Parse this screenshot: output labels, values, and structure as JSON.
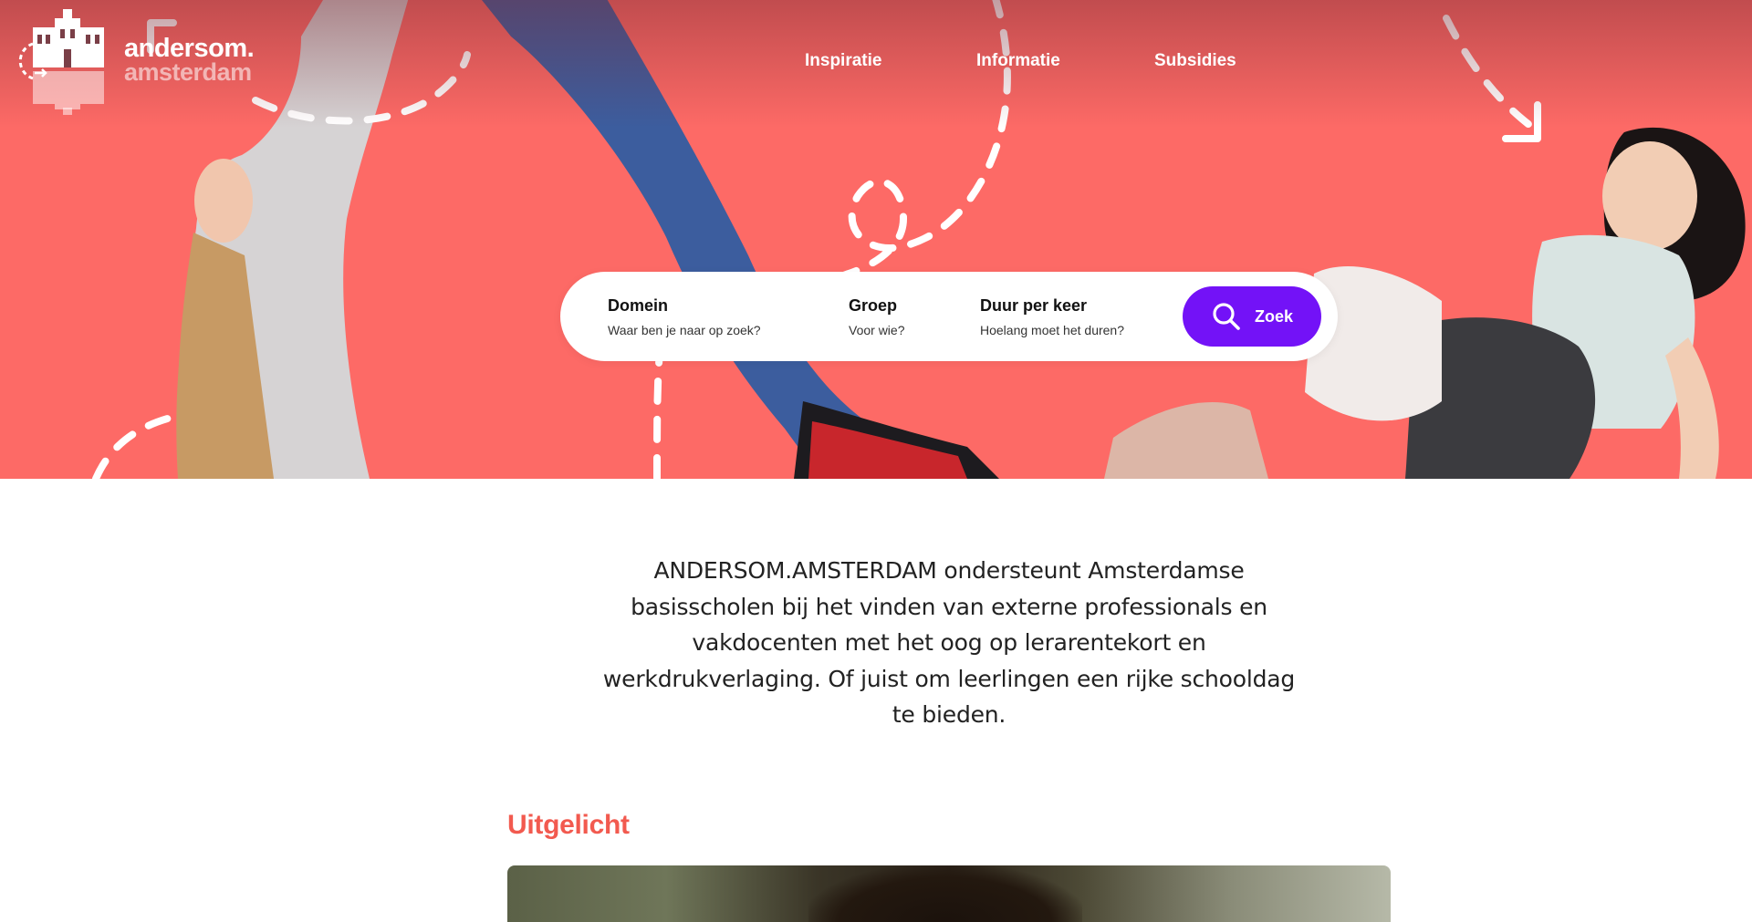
{
  "header": {
    "logo": {
      "line1": "andersom.",
      "line2": "amsterdam"
    },
    "nav": [
      {
        "label": "Inspiratie"
      },
      {
        "label": "Informatie"
      },
      {
        "label": "Subsidies"
      }
    ]
  },
  "hero": {
    "background_color": "#fd6a66"
  },
  "search": {
    "fields": [
      {
        "label": "Domein",
        "sub": "Waar ben je naar op zoek?"
      },
      {
        "label": "Groep",
        "sub": "Voor wie?"
      },
      {
        "label": "Duur per keer",
        "sub": "Hoelang moet het duren?"
      }
    ],
    "button_label": "Zoek",
    "button_icon": "search-icon",
    "button_color": "#7312f7"
  },
  "intro": {
    "text": "ANDERSOM.AMSTERDAM ondersteunt Amsterdamse basisscholen bij het vinden van externe professionals en vakdocenten met het oog op lerarentekort en werkdrukverlaging. Of juist om leerlingen een rijke schooldag te bieden."
  },
  "featured": {
    "title": "Uitgelicht",
    "title_color": "#f25a4f"
  }
}
